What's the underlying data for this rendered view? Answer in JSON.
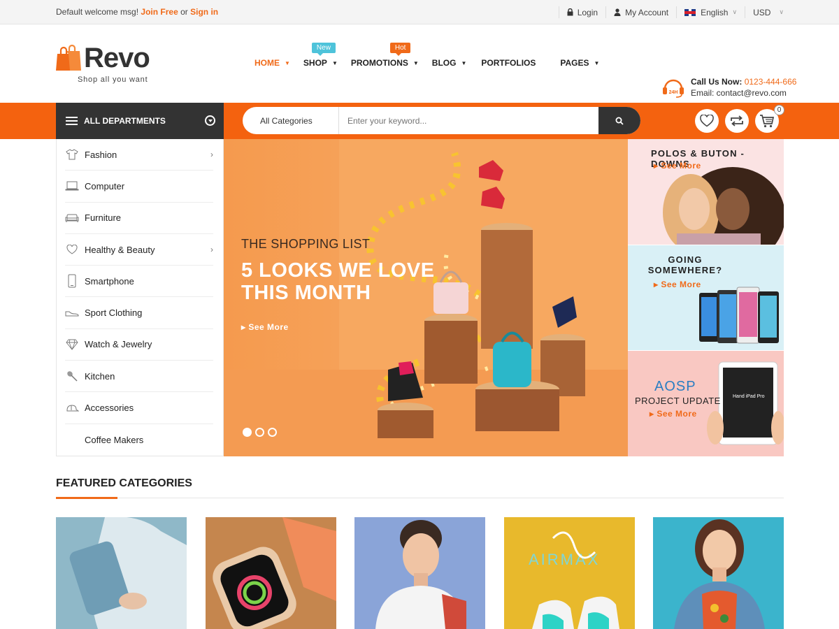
{
  "topbar": {
    "welcome": "Default welcome msg!",
    "join": "Join Free",
    "or": "or",
    "signin": "Sign in",
    "login": "Login",
    "account": "My Account",
    "language": "English",
    "currency": "USD"
  },
  "logo": {
    "name": "Revo",
    "tagline": "Shop all you want"
  },
  "nav": {
    "items": [
      {
        "label": "HOME",
        "caret": "▼"
      },
      {
        "label": "SHOP",
        "caret": "▼",
        "badge": "New"
      },
      {
        "label": "PROMOTIONS",
        "caret": "▼",
        "badge": "Hot"
      },
      {
        "label": "BLOG",
        "caret": "▼"
      },
      {
        "label": "PORTFOLIOS"
      },
      {
        "label": "PAGES",
        "caret": "▼"
      }
    ]
  },
  "contact": {
    "call_label": "Call Us Now:",
    "phone": "0123-444-666",
    "email": "Email: contact@revo.com",
    "badge": "24H"
  },
  "departments": {
    "label": "ALL DEPARTMENTS"
  },
  "search": {
    "category": "All Categories",
    "placeholder": "Enter your keyword..."
  },
  "cart": {
    "count": "0"
  },
  "sidebar": {
    "items": [
      {
        "label": "Fashion",
        "icon": "shirt-icon",
        "arrow": "›"
      },
      {
        "label": "Computer",
        "icon": "laptop-icon"
      },
      {
        "label": "Furniture",
        "icon": "sofa-icon"
      },
      {
        "label": "Healthy & Beauty",
        "icon": "heart-icon",
        "arrow": "›"
      },
      {
        "label": "Smartphone",
        "icon": "phone-icon"
      },
      {
        "label": "Sport Clothing",
        "icon": "shoe-icon"
      },
      {
        "label": "Watch & Jewelry",
        "icon": "diamond-icon"
      },
      {
        "label": "Kitchen",
        "icon": "spoon-icon"
      },
      {
        "label": "Accessories",
        "icon": "cap-icon"
      },
      {
        "label": "Coffee Makers",
        "icon": ""
      }
    ]
  },
  "banner": {
    "kicker": "THE SHOPPING LIST",
    "title": "5 LOOKS WE LOVE THIS MONTH",
    "more": "See More"
  },
  "side_banners": [
    {
      "title": "POLOS & BUTON - DOWNS",
      "more": "See More"
    },
    {
      "title": "GOING SOMEWHERE?",
      "more": "See More"
    },
    {
      "title": "AOSP",
      "subtitle": "PROJECT UPDATE",
      "more": "See More",
      "device_text": "Hand iPad Pro"
    }
  ],
  "featured": {
    "heading": "FEATURED CATEGORIES"
  },
  "colors": {
    "accent": "#f06a19",
    "bar": "#f4620f",
    "dark": "#333333"
  }
}
